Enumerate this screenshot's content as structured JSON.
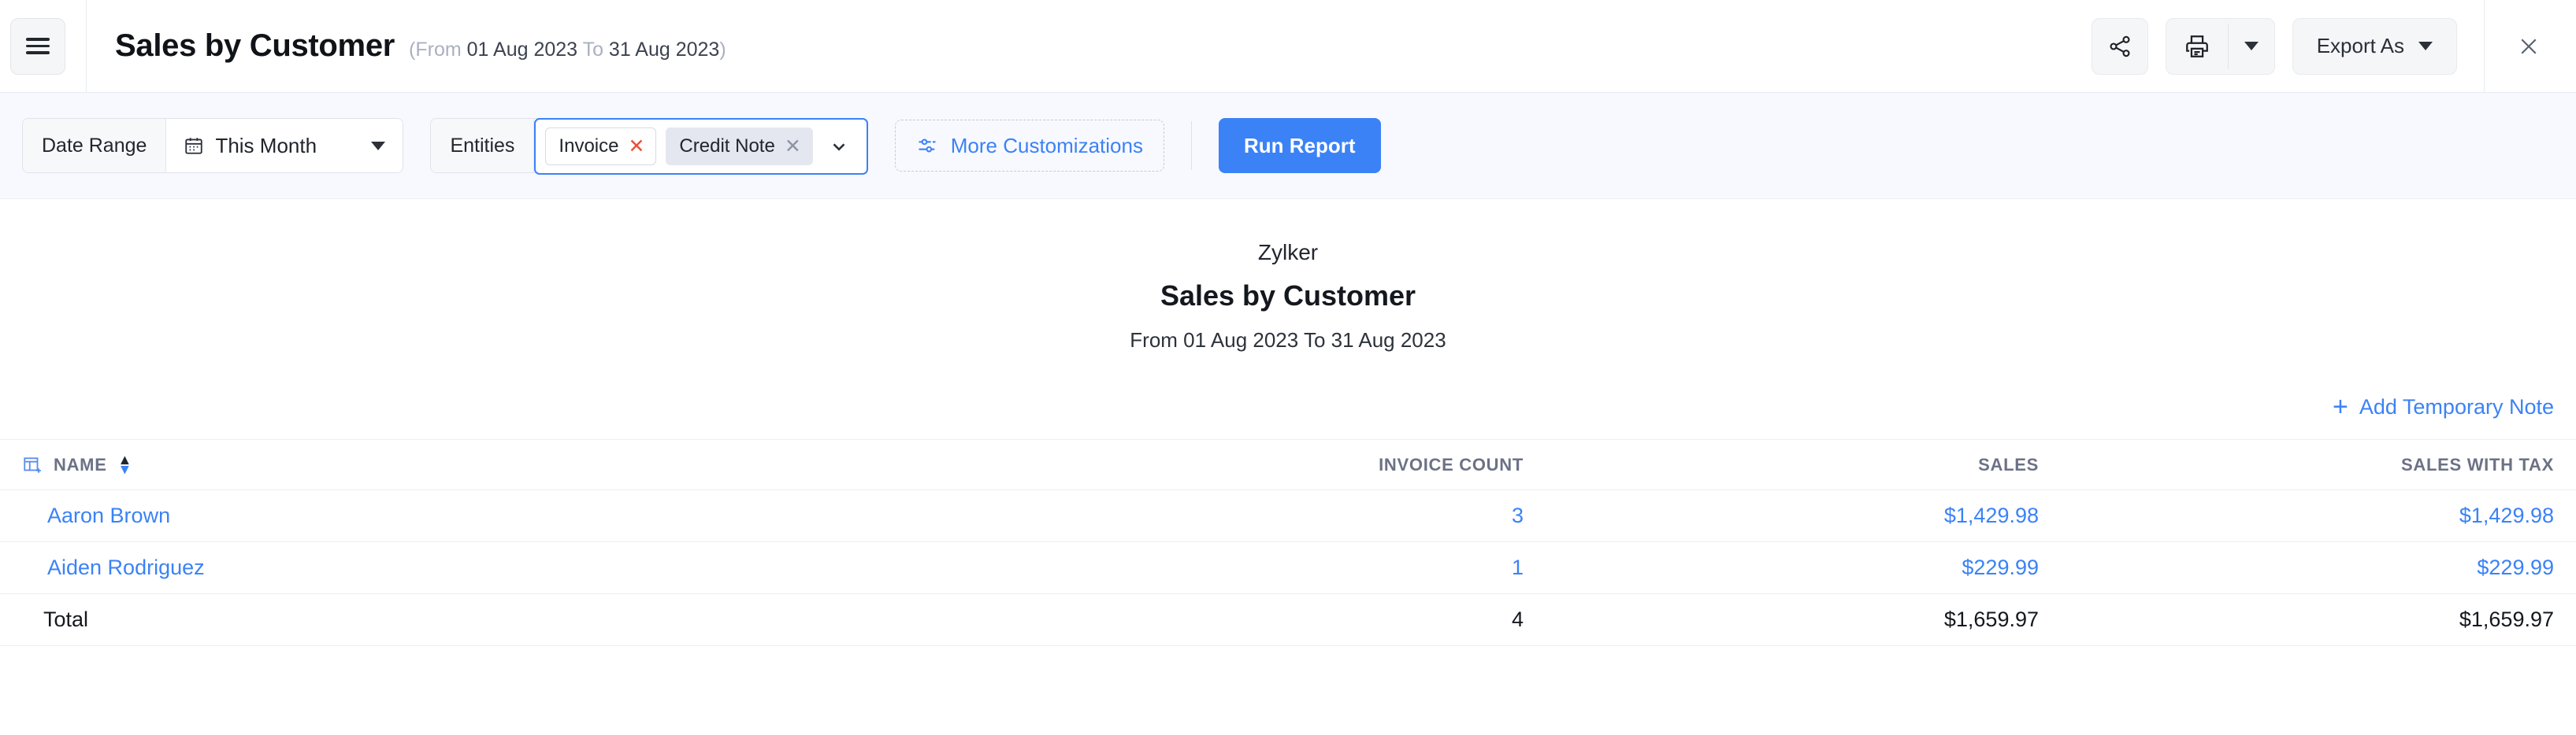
{
  "header": {
    "menu_icon": "hamburger-menu-icon",
    "title": "Sales by Customer",
    "subtitle_open": "(From ",
    "subtitle_from_date": "01 Aug 2023",
    "subtitle_to_word": " To ",
    "subtitle_to_date": "31 Aug 2023",
    "subtitle_close": ")",
    "share_icon": "share-icon",
    "print_icon": "print-icon",
    "print_caret_icon": "chevron-down-icon",
    "export_label": "Export As",
    "export_caret_icon": "chevron-down-icon",
    "close_icon": "close-icon"
  },
  "toolbar": {
    "date_range_label": "Date Range",
    "date_range_value": "This Month",
    "calendar_icon": "calendar-icon",
    "entities_label": "Entities",
    "entity_chips": [
      {
        "label": "Invoice",
        "remove_icon": "close-icon",
        "style": "outlined",
        "x_color": "#e8503a"
      },
      {
        "label": "Credit Note",
        "remove_icon": "close-icon",
        "style": "filled",
        "x_color": "#8d94a3"
      }
    ],
    "entities_caret_icon": "chevron-down-icon",
    "more_customizations_label": "More Customizations",
    "more_customizations_icon": "sliders-icon",
    "run_report_label": "Run Report"
  },
  "report": {
    "org_name": "Zylker",
    "title": "Sales by Customer",
    "date_range": "From 01 Aug 2023 To 31 Aug 2023",
    "add_note_label": "Add Temporary Note",
    "add_note_icon": "plus-icon"
  },
  "table": {
    "add_column_icon": "add-column-icon",
    "sort_icon": "sort-arrows-icon",
    "columns": [
      "NAME",
      "INVOICE COUNT",
      "SALES",
      "SALES WITH TAX"
    ],
    "rows": [
      {
        "name": "Aaron Brown",
        "invoice_count": "3",
        "sales": "$1,429.98",
        "sales_with_tax": "$1,429.98"
      },
      {
        "name": "Aiden Rodriguez",
        "invoice_count": "1",
        "sales": "$229.99",
        "sales_with_tax": "$229.99"
      }
    ],
    "total": {
      "name": "Total",
      "invoice_count": "4",
      "sales": "$1,659.97",
      "sales_with_tax": "$1,659.97"
    }
  },
  "colors": {
    "accent": "#3b82f6",
    "toolbar_bg": "#f8f9fe",
    "chip_remove_red": "#e8503a",
    "header_text": "#6b7285"
  }
}
